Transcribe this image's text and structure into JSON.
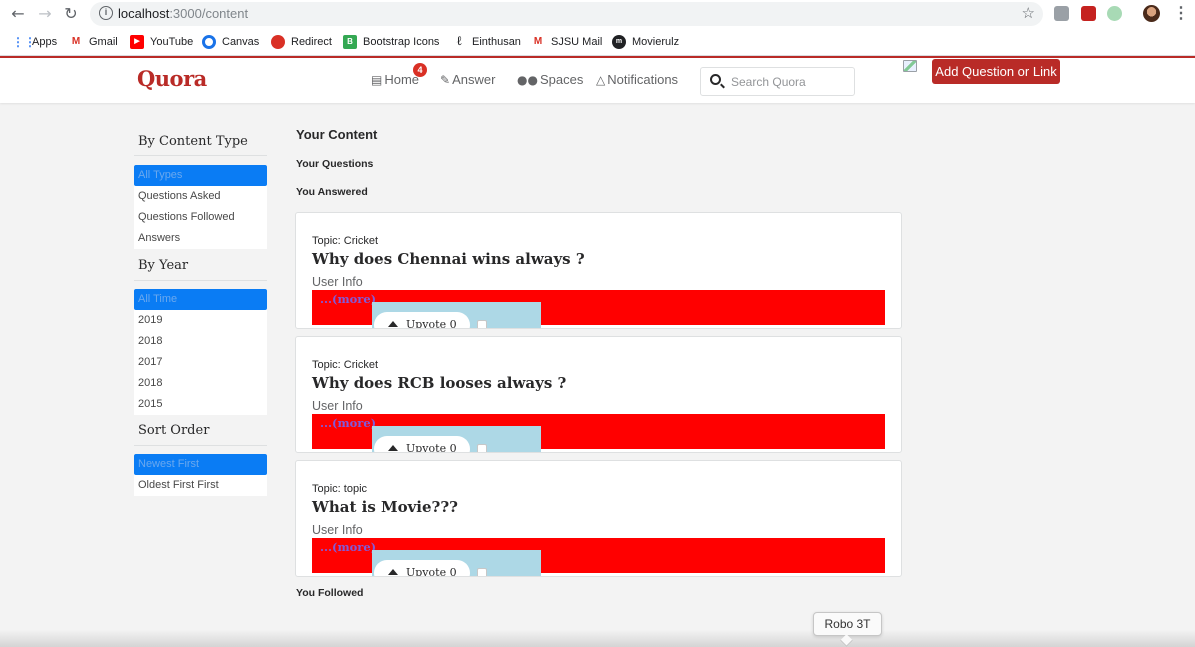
{
  "browser": {
    "url_host": "localhost",
    "url_path": ":3000/content",
    "bookmarks": [
      {
        "label": "Apps",
        "icon": "apps-grid-icon",
        "color": "#4285f4"
      },
      {
        "label": "Gmail",
        "icon": "gmail-icon",
        "color": "#d93025"
      },
      {
        "label": "YouTube",
        "icon": "youtube-icon",
        "color": "#ff0000"
      },
      {
        "label": "Canvas",
        "icon": "canvas-icon",
        "color": "#1a73e8"
      },
      {
        "label": "Redirect",
        "icon": "redirect-icon",
        "color": "#d93025"
      },
      {
        "label": "Bootstrap Icons",
        "icon": "bootstrap-icon",
        "color": "#34a853"
      },
      {
        "label": "Einthusan",
        "icon": "einthusan-icon",
        "color": "#202124"
      },
      {
        "label": "SJSU Mail",
        "icon": "gmail-icon",
        "color": "#d93025"
      },
      {
        "label": "Movierulz",
        "icon": "movierulz-icon",
        "color": "#202124"
      }
    ]
  },
  "header": {
    "logo": "Quora",
    "nav": {
      "home": "Home",
      "answer": "Answer",
      "spaces": "Spaces",
      "notifications": "Notifications"
    },
    "home_badge": "4",
    "search_placeholder": "Search Quora",
    "add_question_label": "Add Question or Link",
    "brand_color": "#b92b27"
  },
  "sidebar": {
    "content_type": {
      "heading": "By Content Type",
      "items": [
        "All Types",
        "Questions Asked",
        "Questions Followed",
        "Answers"
      ]
    },
    "year": {
      "heading": "By Year",
      "items": [
        "All Time",
        "2019",
        "2018",
        "2017",
        "2018",
        "2015"
      ]
    },
    "sort": {
      "heading": "Sort Order",
      "items": [
        "Newest First",
        "Oldest First First"
      ]
    },
    "active_color": "#0a7cf4"
  },
  "main": {
    "title": "Your Content",
    "your_questions": "Your Questions",
    "you_answered": "You Answered",
    "you_followed": "You Followed",
    "cards": [
      {
        "topic": "Topic: Cricket",
        "question": "Why does Chennai wins always ?",
        "user_info": "User Info",
        "more": "...(more)",
        "upvote": "Upvote 0"
      },
      {
        "topic": "Topic: Cricket",
        "question": "Why does RCB looses always ?",
        "user_info": "User Info",
        "more": "...(more)",
        "upvote": "Upvote 0"
      },
      {
        "topic": "Topic: topic",
        "question": "What is Movie???",
        "user_info": "User Info",
        "more": "...(more)",
        "upvote": "Upvote 0"
      }
    ]
  },
  "tooltip": "Robo 3T"
}
